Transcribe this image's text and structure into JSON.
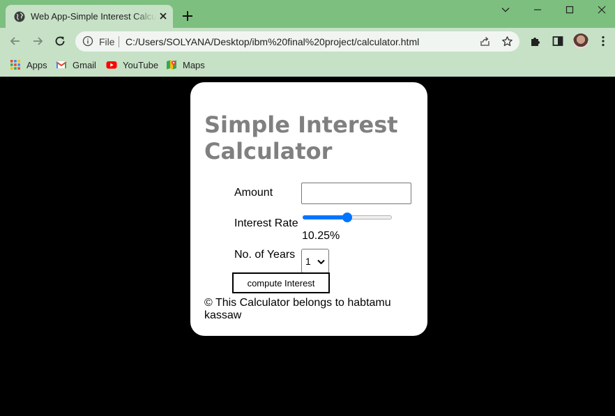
{
  "browser": {
    "tab_title": "Web App-Simple Interest Calculator",
    "url_scheme": "File",
    "url": "C:/Users/SOLYANA/Desktop/ibm%20final%20project/calculator.html",
    "bookmarks": [
      {
        "label": "Apps",
        "icon": "apps-grid-icon"
      },
      {
        "label": "Gmail",
        "icon": "gmail-icon"
      },
      {
        "label": "YouTube",
        "icon": "youtube-icon"
      },
      {
        "label": "Maps",
        "icon": "maps-icon"
      }
    ],
    "colors": {
      "tab_strip": "#7dbf7e",
      "toolbar": "#c6e1c6",
      "omnibox": "#f1f5f1"
    }
  },
  "calculator": {
    "title": "Simple Interest Calculator",
    "amount_label": "Amount",
    "amount_value": "",
    "rate_label": "Interest Rate",
    "rate_slider_fraction": 0.5,
    "rate_display": "10.25%",
    "years_label": "No. of Years",
    "years_selected": "1",
    "compute_button": "compute Interest",
    "footer": "© This Calculator belongs to habtamu kassaw",
    "colors": {
      "title": "#808080",
      "slider": "#0075ff",
      "card": "#ffffff",
      "page_background": "#000000"
    }
  }
}
